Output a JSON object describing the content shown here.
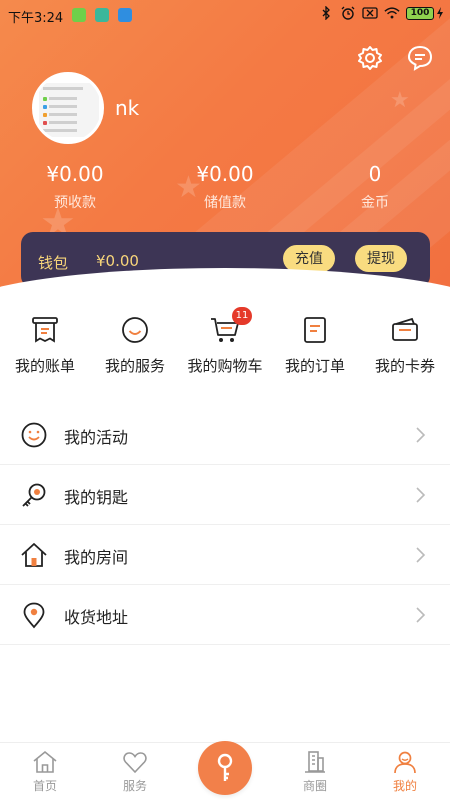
{
  "status": {
    "time": "下午3:24",
    "battery": "100"
  },
  "profile": {
    "username": "nk"
  },
  "stats": [
    {
      "value": "¥0.00",
      "label": "预收款"
    },
    {
      "value": "¥0.00",
      "label": "储值款"
    },
    {
      "value": "0",
      "label": "金币"
    }
  ],
  "wallet": {
    "label": "钱包",
    "value": "¥0.00",
    "recharge_label": "充值",
    "withdraw_label": "提现"
  },
  "quick": [
    {
      "label": "我的账单",
      "icon": "bill-icon"
    },
    {
      "label": "我的服务",
      "icon": "smile-icon"
    },
    {
      "label": "我的购物车",
      "icon": "cart-icon"
    },
    {
      "label": "我的订单",
      "icon": "order-icon"
    },
    {
      "label": "我的卡券",
      "icon": "coupon-icon"
    }
  ],
  "cart_badge": "11",
  "list": [
    {
      "label": "我的活动",
      "icon": "activity-face-icon"
    },
    {
      "label": "我的钥匙",
      "icon": "key-icon"
    },
    {
      "label": "我的房间",
      "icon": "house-icon"
    },
    {
      "label": "收货地址",
      "icon": "location-pin-icon"
    }
  ],
  "nav": [
    {
      "label": "首页",
      "icon": "home-icon"
    },
    {
      "label": "服务",
      "icon": "heart-icon"
    },
    {
      "label": "",
      "icon": "key-center-icon"
    },
    {
      "label": "商圈",
      "icon": "building-icon"
    },
    {
      "label": "我的",
      "icon": "person-icon"
    }
  ],
  "colors": {
    "header_orange": "#f47a44",
    "wallet_bg": "#3d3555",
    "wallet_text": "#f7d57a",
    "pill_bg": "#f9dc80",
    "accent": "#f08040",
    "badge": "#e53a2a"
  }
}
